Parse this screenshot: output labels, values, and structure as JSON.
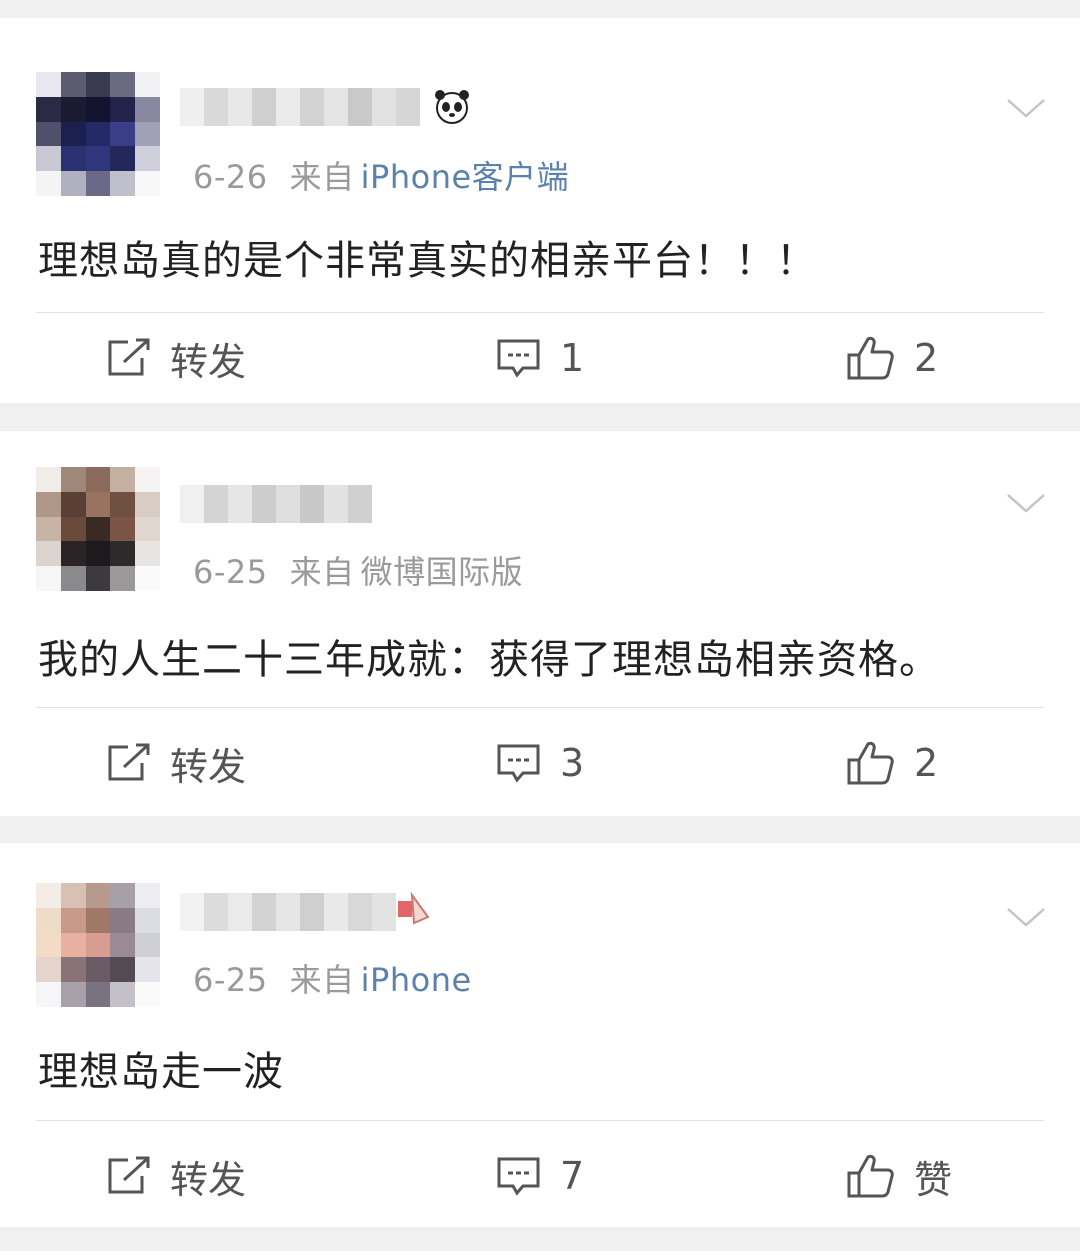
{
  "posts": [
    {
      "date": "6-26",
      "from_label": "来自",
      "source": "iPhone客户端",
      "content": "理想岛真的是个非常真实的相亲平台！！！",
      "repost_label": "转发",
      "comment_count": "1",
      "like_label": "2",
      "decor_icon": "panda-emoji-icon"
    },
    {
      "date": "6-25",
      "from_label": "来自",
      "source": "微博国际版",
      "content": "我的人生二十三年成就：获得了理想岛相亲资格。",
      "repost_label": "转发",
      "comment_count": "3",
      "like_label": "2"
    },
    {
      "date": "6-25",
      "from_label": "来自",
      "source": "iPhone",
      "content": "理想岛走一波",
      "repost_label": "转发",
      "comment_count": "7",
      "like_label": "赞",
      "decor_icon": "badge-icon"
    }
  ],
  "colors": {
    "source_link": "#5b81ad",
    "meta_text": "#9a9a9a",
    "body_text": "#222222",
    "separator": "#f0f0f0"
  }
}
